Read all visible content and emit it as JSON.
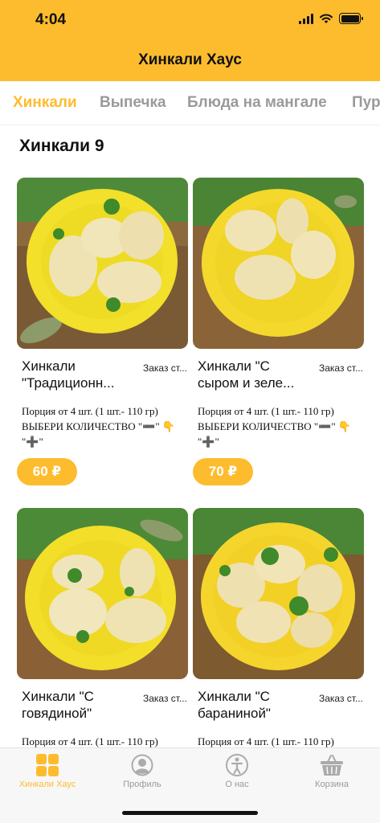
{
  "status_bar": {
    "time": "4:04"
  },
  "header": {
    "title": "Хинкали Хаус"
  },
  "tabs": [
    {
      "label": "Хинкали",
      "active": true
    },
    {
      "label": "Выпечка",
      "active": false
    },
    {
      "label": "Блюда на мангале",
      "active": false
    },
    {
      "label": "Пур",
      "active": false
    }
  ],
  "section": {
    "title": "Хинкали 9"
  },
  "products": [
    {
      "title": "Хинкали \"Традиционн...",
      "order_label": "Заказ ст...",
      "description": "Порция от 4 шт. (1 шт.- 110 гр) ВЫБЕРИ КОЛИЧЕСТВО \"➖\" 👇 \"➕\"",
      "price": "60 ₽"
    },
    {
      "title": "Хинкали \"С сыром и зеле...",
      "order_label": "Заказ ст...",
      "description": "Порция от 4 шт. (1 шт.- 110 гр) ВЫБЕРИ КОЛИЧЕСТВО \"➖\" 👇 \"➕\"",
      "price": "70 ₽"
    },
    {
      "title": "Хинкали \"С говядиной\"",
      "order_label": "Заказ ст...",
      "description": "Порция от 4 шт. (1 шт.- 110 гр)",
      "price": ""
    },
    {
      "title": "Хинкали \"С бараниной\"",
      "order_label": "Заказ ст...",
      "description": "Порция от 4 шт. (1 шт.- 110 гр)",
      "price": ""
    }
  ],
  "tabbar": [
    {
      "label": "Хинкали Хаус",
      "icon": "grid-icon",
      "active": true
    },
    {
      "label": "Профиль",
      "icon": "profile-icon",
      "active": false
    },
    {
      "label": "О нас",
      "icon": "info-person-icon",
      "active": false
    },
    {
      "label": "Корзина",
      "icon": "basket-icon",
      "active": false
    }
  ],
  "colors": {
    "accent": "#FDBC2E",
    "inactive": "#9A9A9A"
  }
}
